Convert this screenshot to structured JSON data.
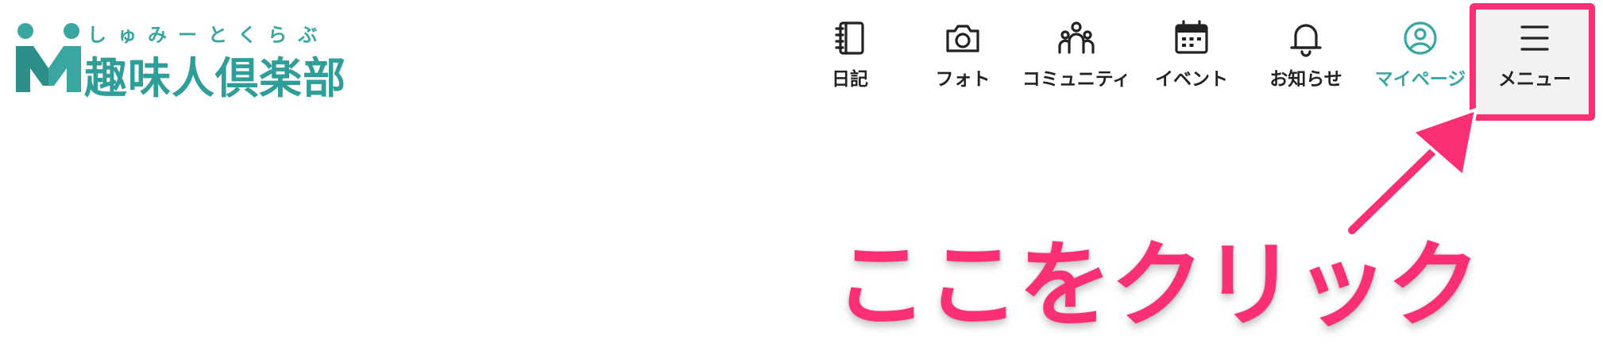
{
  "logo": {
    "ruby": "しゅみーとくらぶ",
    "name": "趣味人倶楽部"
  },
  "nav": {
    "items": [
      {
        "label": "日記",
        "icon": "diary-icon"
      },
      {
        "label": "フォト",
        "icon": "camera-icon"
      },
      {
        "label": "コミュニティ",
        "icon": "community-icon"
      },
      {
        "label": "イベント",
        "icon": "calendar-icon"
      },
      {
        "label": "お知らせ",
        "icon": "bell-icon"
      },
      {
        "label": "マイページ",
        "icon": "user-circle-icon",
        "active": true
      },
      {
        "label": "メニュー",
        "icon": "hamburger-icon"
      }
    ]
  },
  "callout": {
    "text": "ここをクリック"
  },
  "colors": {
    "brand": "#3aa6a0",
    "highlight": "#fb2f74",
    "text": "#222222",
    "menu_bg": "#f2f2f2"
  }
}
